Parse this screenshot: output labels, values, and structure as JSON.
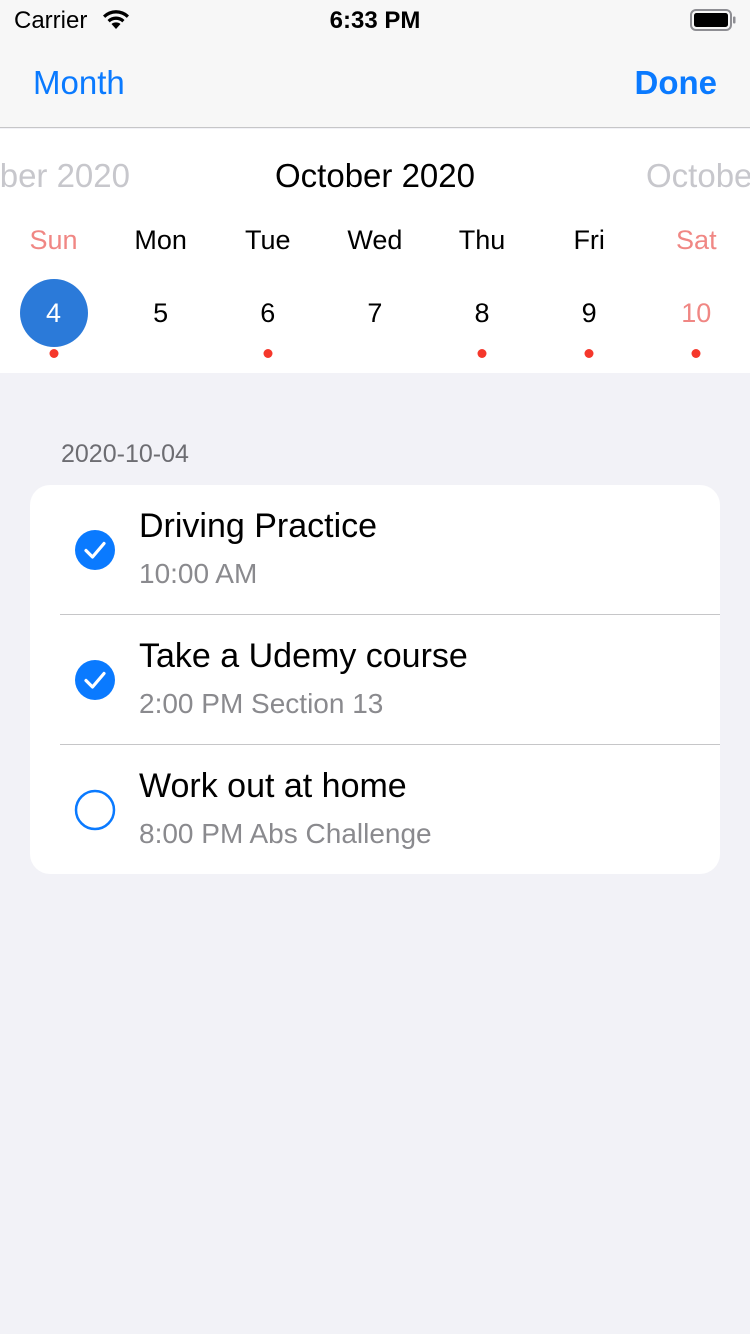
{
  "status_bar": {
    "carrier": "Carrier",
    "time": "6:33 PM"
  },
  "nav": {
    "left_label": "Month",
    "right_label": "Done"
  },
  "calendar": {
    "prev_month": "ber 2020",
    "current_month": "October 2020",
    "next_month": "Octobe",
    "weekdays": [
      "Sun",
      "Mon",
      "Tue",
      "Wed",
      "Thu",
      "Fri",
      "Sat"
    ],
    "dates": [
      "4",
      "5",
      "6",
      "7",
      "8",
      "9",
      "10"
    ],
    "selected_date": "4",
    "has_event": [
      true,
      false,
      true,
      false,
      true,
      true,
      true
    ]
  },
  "section": {
    "date": "2020-10-04"
  },
  "tasks": [
    {
      "title": "Driving Practice",
      "subtitle": "10:00 AM",
      "done": true
    },
    {
      "title": "Take a Udemy course",
      "subtitle": "2:00 PM Section 13",
      "done": true
    },
    {
      "title": "Work out at home",
      "subtitle": "8:00 PM Abs Challenge",
      "done": false
    }
  ],
  "colors": {
    "accent": "#0a7aff",
    "selected_date_bg": "#2b7ad9",
    "weekend": "#f08784",
    "event_dot": "#f5372b"
  }
}
